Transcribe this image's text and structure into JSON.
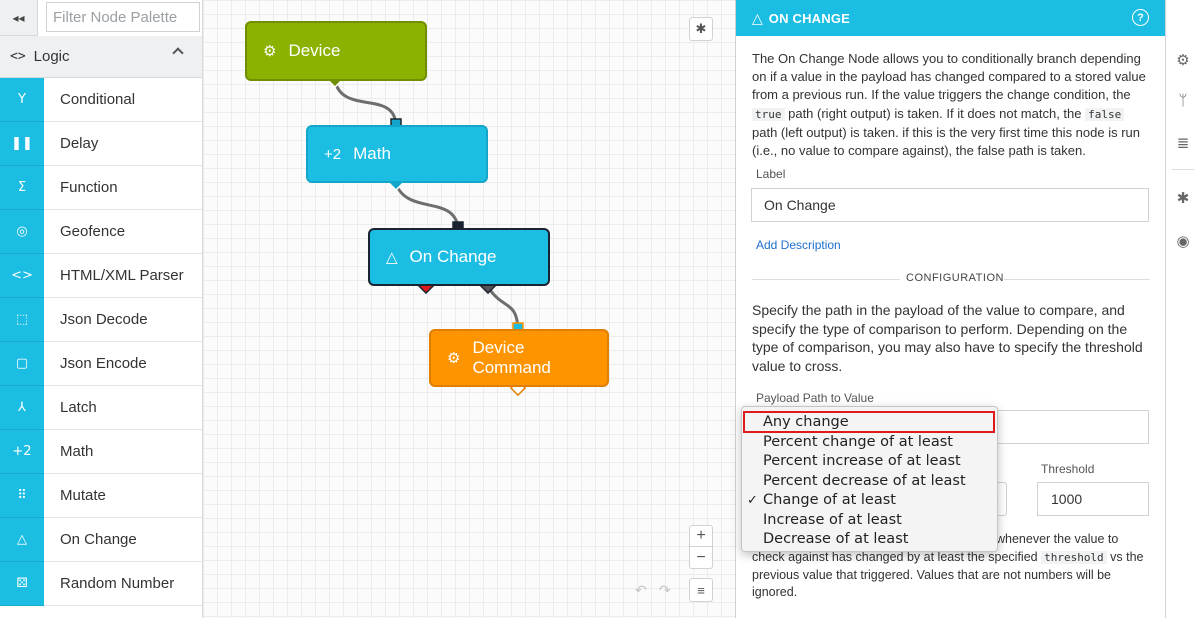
{
  "palette": {
    "filter_placeholder": "Filter Node Palette",
    "collapse_glyph": "◂◂",
    "category": {
      "icon_glyph": "<>",
      "label": "Logic"
    },
    "items": [
      {
        "label": "Conditional",
        "icon": "branch-icon",
        "glyph": "Y"
      },
      {
        "label": "Delay",
        "icon": "pause-icon",
        "glyph": "❚❚"
      },
      {
        "label": "Function",
        "icon": "sigma-icon",
        "glyph": "Σ"
      },
      {
        "label": "Geofence",
        "icon": "target-icon",
        "glyph": "◎"
      },
      {
        "label": "HTML/XML Parser",
        "icon": "code-icon",
        "glyph": "<>"
      },
      {
        "label": "Json Decode",
        "icon": "json-decode-icon",
        "glyph": "⬚"
      },
      {
        "label": "Json Encode",
        "icon": "json-encode-icon",
        "glyph": "▢"
      },
      {
        "label": "Latch",
        "icon": "latch-icon",
        "glyph": "⅄"
      },
      {
        "label": "Math",
        "icon": "math-icon",
        "glyph": "+2"
      },
      {
        "label": "Mutate",
        "icon": "mutate-icon",
        "glyph": "⠿"
      },
      {
        "label": "On Change",
        "icon": "triangle-icon",
        "glyph": "△"
      },
      {
        "label": "Random Number",
        "icon": "dice-icon",
        "glyph": "⚄"
      }
    ]
  },
  "canvas": {
    "nodes": {
      "device": {
        "label": "Device",
        "glyph": "⚙"
      },
      "math": {
        "label": "Math",
        "glyph": "+2"
      },
      "on_change": {
        "label": "On Change",
        "glyph": "△"
      },
      "device_command": {
        "label": "Device Command",
        "glyph": "⚙"
      }
    },
    "debug_glyph": "✱",
    "zoom_in": "+",
    "zoom_out": "−",
    "undo": "↶",
    "redo": "↷",
    "menu": "≡"
  },
  "panel": {
    "header": {
      "icon_glyph": "△",
      "title": "ON CHANGE",
      "help": "?"
    },
    "description": {
      "p1": "The On Change Node allows you to conditionally branch depending on if a value in the payload has changed compared to a stored value from a previous run. If the value triggers the change condition, the ",
      "code1": "true",
      "p2": " path (right output) is taken. If it does not match, the ",
      "code2": "false",
      "p3": " path (left output) is taken. if this is the very first time this node is run (i.e., no value to compare against), the false path is taken."
    },
    "label_caption": "Label",
    "label_value": "On Change",
    "add_description": "Add Description",
    "configuration_title": "CONFIGURATION",
    "configuration_text": "Specify the path in the payload of the value to compare, and specify the type of comparison to perform. Depending on the type of comparison, you may also have to specify the threshold value to cross.",
    "payload_path_caption": "Payload Path to Value",
    "payload_path_value": "",
    "threshold_caption": "Threshold",
    "threshold_value": "1000",
    "bottom_text": {
      "lead": "",
      "t1": "whenever the value to check against has changed by at least the specified ",
      "code": "threshold",
      "t2": " vs the previous value that triggered. Values that are not numbers will be ignored."
    }
  },
  "dropdown": {
    "options": [
      "Any change",
      "Percent change of at least",
      "Percent increase of at least",
      "Percent decrease of at least",
      "Change of at least",
      "Increase of at least",
      "Decrease of at least"
    ],
    "selected": "Change of at least",
    "check_glyph": "✓",
    "highlighted": "Any change"
  },
  "right_toolbar": {
    "icons": [
      {
        "name": "gear-icon",
        "glyph": "⚙"
      },
      {
        "name": "branch-icon",
        "glyph": "ᛘ"
      },
      {
        "name": "database-icon",
        "glyph": "≣"
      },
      {
        "name": "bug-icon",
        "glyph": "✱"
      },
      {
        "name": "globe-icon",
        "glyph": "◉"
      }
    ]
  },
  "colors": {
    "accent": "#1bbde2",
    "device_node": "#8bb200",
    "command_node": "#fd9400",
    "highlight": "#e0191c",
    "false_port": "#e0191c",
    "true_port": "#555555"
  }
}
